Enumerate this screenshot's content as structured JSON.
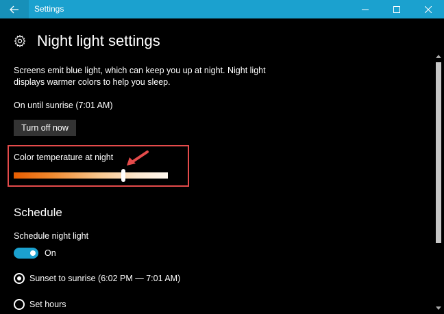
{
  "window": {
    "title": "Settings"
  },
  "page": {
    "title": "Night light settings",
    "description": "Screens emit blue light, which can keep you up at night. Night light displays warmer colors to help you sleep.",
    "status": "On until sunrise (7:01 AM)",
    "turn_off_button": "Turn off now"
  },
  "color_temperature": {
    "label": "Color temperature at night",
    "value_fraction": 0.71
  },
  "schedule": {
    "heading": "Schedule",
    "label": "Schedule night light",
    "toggle_text": "On",
    "options": [
      {
        "label": "Sunset to sunrise (6:02 PM — 7:01 AM)",
        "selected": true
      },
      {
        "label": "Set hours",
        "selected": false
      }
    ]
  },
  "colors": {
    "accent": "#1ba1cf",
    "highlight": "#e54b4b"
  }
}
